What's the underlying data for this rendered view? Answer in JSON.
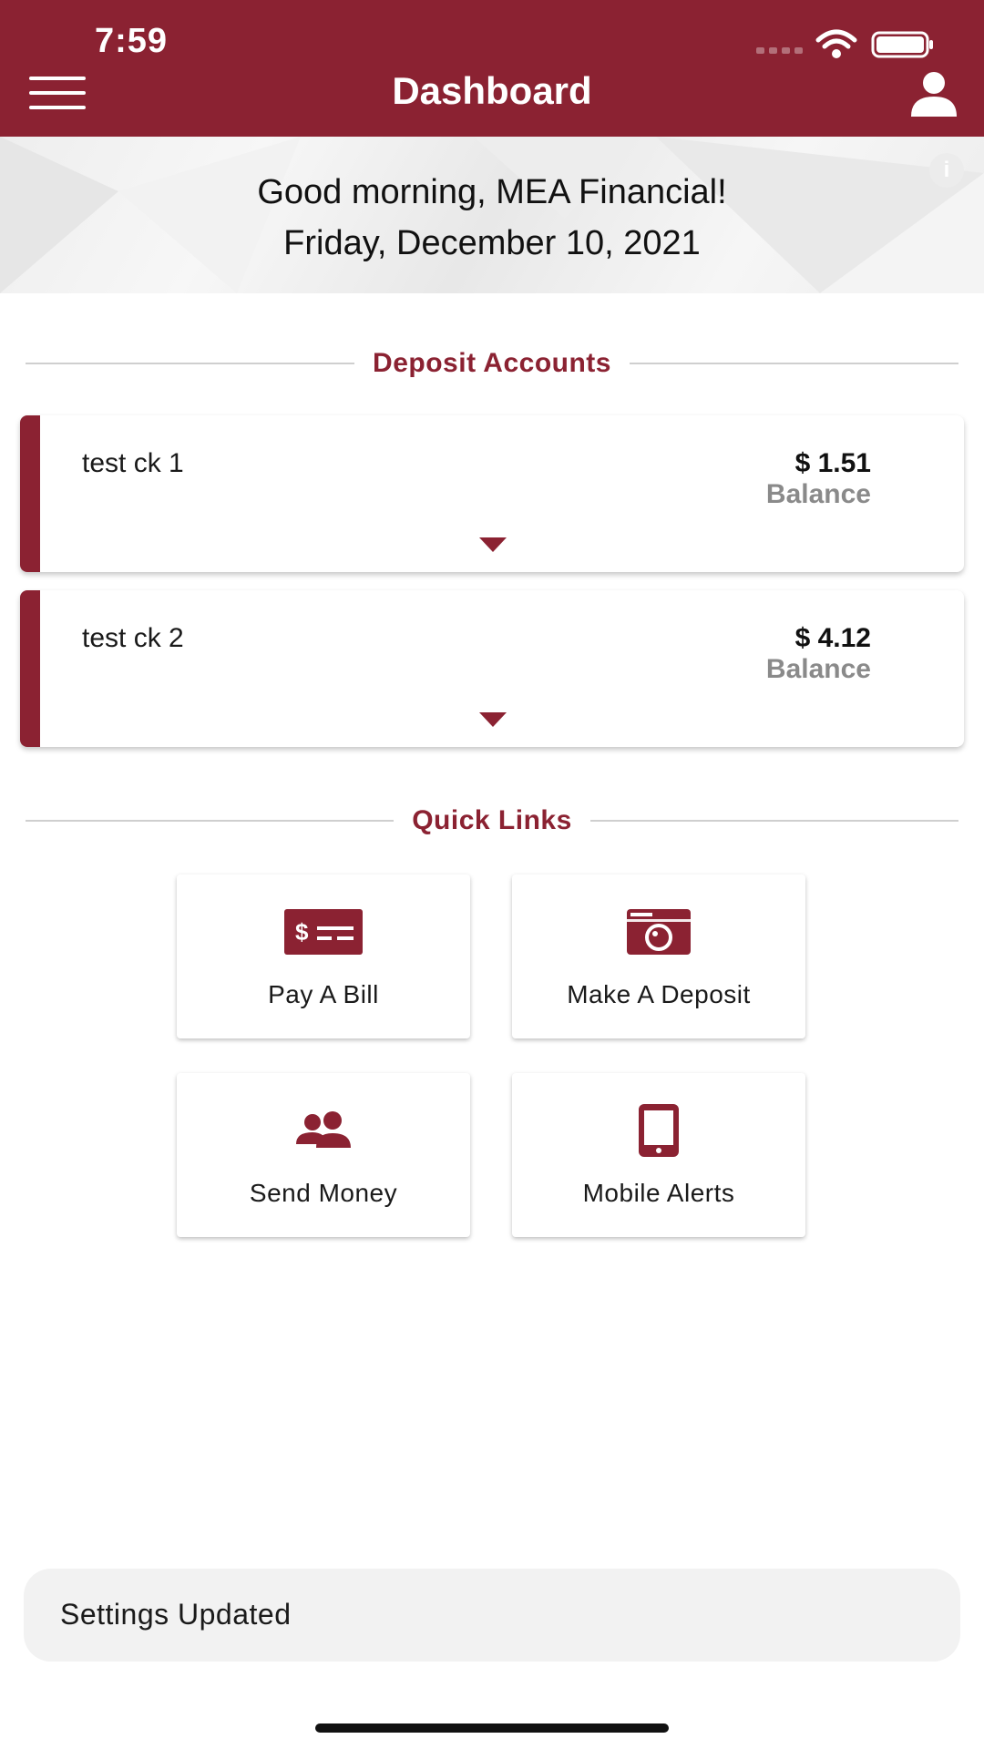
{
  "status_bar": {
    "time": "7:59"
  },
  "header": {
    "title": "Dashboard"
  },
  "banner": {
    "greeting": "Good morning, MEA Financial!",
    "date": "Friday, December 10, 2021",
    "info_glyph": "i"
  },
  "deposit_section": {
    "title": "Deposit Accounts"
  },
  "accounts": [
    {
      "name": "test ck 1",
      "amount": "$ 1.51",
      "label": "Balance"
    },
    {
      "name": "test ck 2",
      "amount": "$ 4.12",
      "label": "Balance"
    }
  ],
  "quick_links": {
    "title": "Quick Links",
    "items": [
      {
        "label": "Pay A Bill",
        "icon": "bill-icon"
      },
      {
        "label": "Make A Deposit",
        "icon": "camera-icon"
      },
      {
        "label": "Send Money",
        "icon": "people-icon"
      },
      {
        "label": "Mobile Alerts",
        "icon": "phone-icon"
      }
    ]
  },
  "toast": {
    "message": "Settings Updated"
  },
  "colors": {
    "brand": "#8b2232",
    "muted_text": "#8a8a8a"
  }
}
